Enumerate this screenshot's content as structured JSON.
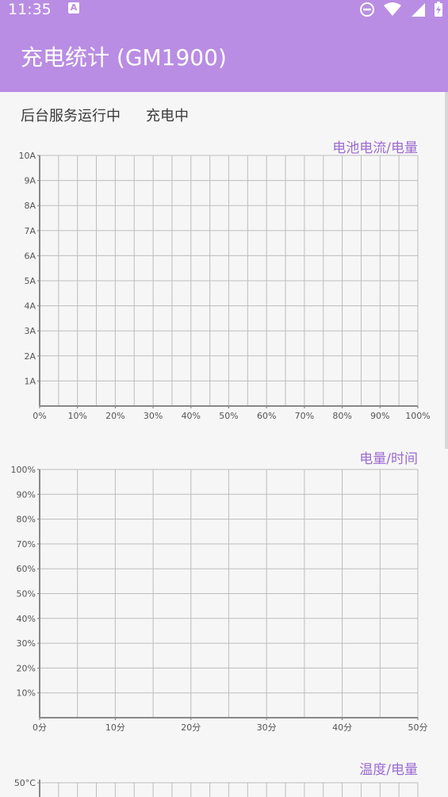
{
  "status_bar": {
    "time": "11:35",
    "notification_letter": "A",
    "icons": [
      "dnd-icon",
      "wifi-icon",
      "signal-icon",
      "battery-charging-icon"
    ]
  },
  "app_bar": {
    "title": "充电统计 (GM1900)"
  },
  "status": {
    "service": "后台服务运行中",
    "charging": "充电中"
  },
  "chart_data": [
    {
      "type": "line",
      "title": "电池电流/电量",
      "x_ticks": [
        "0%",
        "10%",
        "20%",
        "30%",
        "40%",
        "50%",
        "60%",
        "70%",
        "80%",
        "90%",
        "100%"
      ],
      "y_ticks": [
        "1A",
        "2A",
        "3A",
        "4A",
        "5A",
        "6A",
        "7A",
        "8A",
        "9A",
        "10A"
      ],
      "xlim": [
        0,
        100
      ],
      "ylim": [
        0,
        10
      ],
      "grid": true,
      "series": []
    },
    {
      "type": "line",
      "title": "电量/时间",
      "x_ticks": [
        "0分",
        "10分",
        "20分",
        "30分",
        "40分",
        "50分"
      ],
      "y_ticks": [
        "10%",
        "20%",
        "30%",
        "40%",
        "50%",
        "60%",
        "70%",
        "80%",
        "90%",
        "100%"
      ],
      "xlim": [
        0,
        50
      ],
      "ylim": [
        0,
        100
      ],
      "grid": true,
      "series": []
    },
    {
      "type": "line",
      "title": "温度/电量",
      "y_ticks": [
        "50°C"
      ],
      "grid": true,
      "series": []
    }
  ]
}
